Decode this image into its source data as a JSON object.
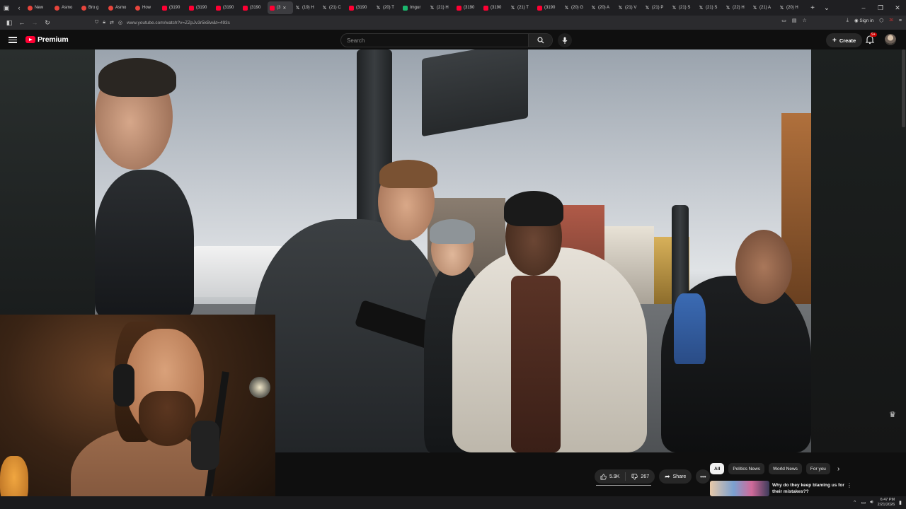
{
  "browser": {
    "tabs": [
      {
        "label": "New",
        "icon": "chrome-icon"
      },
      {
        "label": "Asmo",
        "icon": "chrome-icon"
      },
      {
        "label": "Bro g",
        "icon": "chrome-icon"
      },
      {
        "label": "Asmo",
        "icon": "chrome-icon"
      },
      {
        "label": "How",
        "icon": "chrome-icon"
      },
      {
        "label": "(3190",
        "icon": "youtube-icon"
      },
      {
        "label": "(3190",
        "icon": "youtube-icon"
      },
      {
        "label": "(3190",
        "icon": "youtube-icon"
      },
      {
        "label": "(3190",
        "icon": "youtube-icon"
      },
      {
        "label": "(3",
        "icon": "youtube-icon",
        "active": true
      },
      {
        "label": "(19) H",
        "icon": "x-icon"
      },
      {
        "label": "(21) C",
        "icon": "x-icon"
      },
      {
        "label": "(3190",
        "icon": "youtube-icon"
      },
      {
        "label": "(20) T",
        "icon": "x-icon"
      },
      {
        "label": "Imgur",
        "icon": "imgur-icon"
      },
      {
        "label": "(21) H",
        "icon": "x-icon"
      },
      {
        "label": "(3190",
        "icon": "youtube-icon"
      },
      {
        "label": "(3190",
        "icon": "youtube-icon"
      },
      {
        "label": "(21) T",
        "icon": "x-icon"
      },
      {
        "label": "(3190",
        "icon": "youtube-icon"
      },
      {
        "label": "(20) G",
        "icon": "x-icon"
      },
      {
        "label": "(20) A",
        "icon": "x-icon"
      },
      {
        "label": "(21) V",
        "icon": "x-icon"
      },
      {
        "label": "(21) P",
        "icon": "x-icon"
      },
      {
        "label": "(21) S",
        "icon": "x-icon"
      },
      {
        "label": "(21) S",
        "icon": "x-icon"
      },
      {
        "label": "(22) H",
        "icon": "x-icon"
      },
      {
        "label": "(21) A",
        "icon": "x-icon"
      },
      {
        "label": "(20) H",
        "icon": "x-icon"
      }
    ],
    "url": "www.youtube.com/watch?v=ZZpJv3r5kBw&t=493s",
    "signin_label": "Sign in",
    "ext_badge": "26"
  },
  "youtube": {
    "brand": "Premium",
    "search_placeholder": "Search",
    "create_label": "Create",
    "notification_badge": "9+",
    "like_count": "5.9K",
    "dislike_count": "267",
    "share_label": "Share",
    "chips": [
      "All",
      "Politics News",
      "World News",
      "For you"
    ],
    "recommendation_title": "Why do they keep blaming us for their mistakes??"
  },
  "taskbar": {
    "time": "6:47 PM",
    "date": "2/21/2026"
  },
  "colors": {
    "brand_red": "#ff0033",
    "background": "#0f0f0f",
    "pill": "#272727"
  }
}
